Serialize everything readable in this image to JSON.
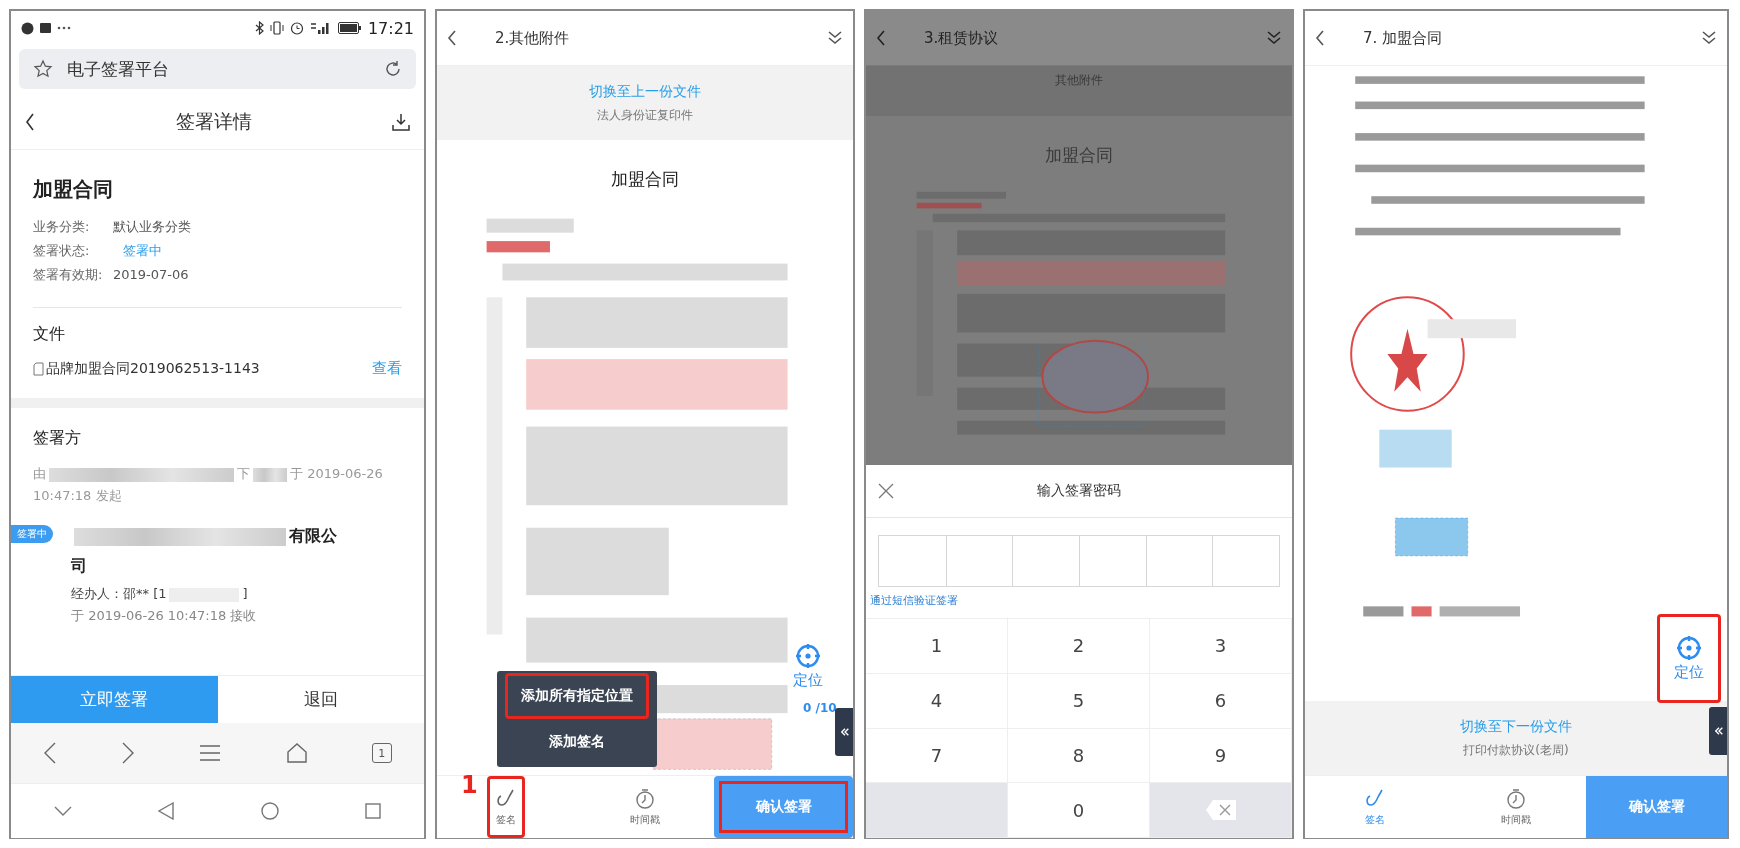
{
  "detail_screen": {
    "status_bar": {
      "time": "17:21"
    },
    "address_bar": {
      "title": "电子签署平台"
    },
    "header": {
      "title": "签署详情"
    },
    "contract": {
      "title": "加盟合同",
      "fields": [
        {
          "label": "业务分类:",
          "value": "默认业务分类",
          "kind": "plain"
        },
        {
          "label": "签署状态:",
          "value": "签署中",
          "kind": "status"
        },
        {
          "label": "签署有效期:",
          "value": "2019-07-06",
          "kind": "plain"
        }
      ]
    },
    "files": {
      "heading": "文件",
      "items": [
        {
          "name": "品牌加盟合同2019062513-1143",
          "action": "查看"
        }
      ]
    },
    "signers": {
      "heading": "签署方",
      "initiator": {
        "prefix": "由",
        "middle": "下",
        "suffix": "于 2019-06-26 10:47:18 发起"
      },
      "parties": [
        {
          "status": "签署中",
          "name_end": "有限公司",
          "operator": "经办人：邵** [1",
          "operator_end": "]",
          "received": "于 2019-06-26 10:47:18 接收"
        }
      ]
    },
    "buttons": [
      {
        "label": "立即签署",
        "kind": "primary"
      },
      {
        "label": "退回",
        "kind": "secondary"
      }
    ],
    "browser_nav": {
      "tab_count": "1"
    }
  },
  "attachment_screen": {
    "header": {
      "title": "2.其他附件"
    },
    "banner": {
      "link": "切换至上一份文件",
      "caption": "法人身份证复印件"
    },
    "document": {
      "title": "加盟合同"
    },
    "locate": {
      "label": "定位",
      "count": "0 /10",
      "highlighted": false
    },
    "menu": {
      "items": [
        {
          "label": "添加所有指定位置",
          "highlighted": true
        },
        {
          "label": "添加签名",
          "highlighted": false
        }
      ]
    },
    "annotation": "1",
    "toolbar": {
      "items": [
        {
          "label": "签名",
          "kind": "sign",
          "selected": false,
          "highlighted": true
        },
        {
          "label": "时间戳",
          "kind": "timestamp",
          "selected": false,
          "highlighted": false
        }
      ],
      "confirm": {
        "label": "确认签署",
        "highlighted": true
      }
    }
  },
  "password_screen": {
    "header": {
      "title": "3.租赁协议"
    },
    "banner": {
      "caption": "其他附件"
    },
    "document": {
      "title": "加盟合同"
    },
    "dialog": {
      "title": "输入签署密码",
      "sms_link": "通过短信验证签署",
      "keys": [
        {
          "label": "1",
          "kind": "digit"
        },
        {
          "label": "2",
          "kind": "digit"
        },
        {
          "label": "3",
          "kind": "digit"
        },
        {
          "label": "4",
          "kind": "digit"
        },
        {
          "label": "5",
          "kind": "digit"
        },
        {
          "label": "6",
          "kind": "digit"
        },
        {
          "label": "7",
          "kind": "digit"
        },
        {
          "label": "8",
          "kind": "digit"
        },
        {
          "label": "9",
          "kind": "digit"
        },
        {
          "kind": "blank"
        },
        {
          "label": "0",
          "kind": "digit"
        },
        {
          "kind": "backspace"
        }
      ]
    }
  },
  "contract_screen": {
    "header": {
      "title": "7. 加盟合同"
    },
    "locate": {
      "label": "定位",
      "highlighted": true
    },
    "banner": {
      "link": "切换至下一份文件",
      "caption": "打印付款协议(老周)"
    },
    "toolbar": {
      "items": [
        {
          "label": "签名",
          "kind": "sign",
          "selected": true,
          "highlighted": false
        },
        {
          "label": "时间戳",
          "kind": "timestamp",
          "selected": false,
          "highlighted": false
        }
      ],
      "confirm": {
        "label": "确认签署",
        "highlighted": false
      }
    }
  }
}
